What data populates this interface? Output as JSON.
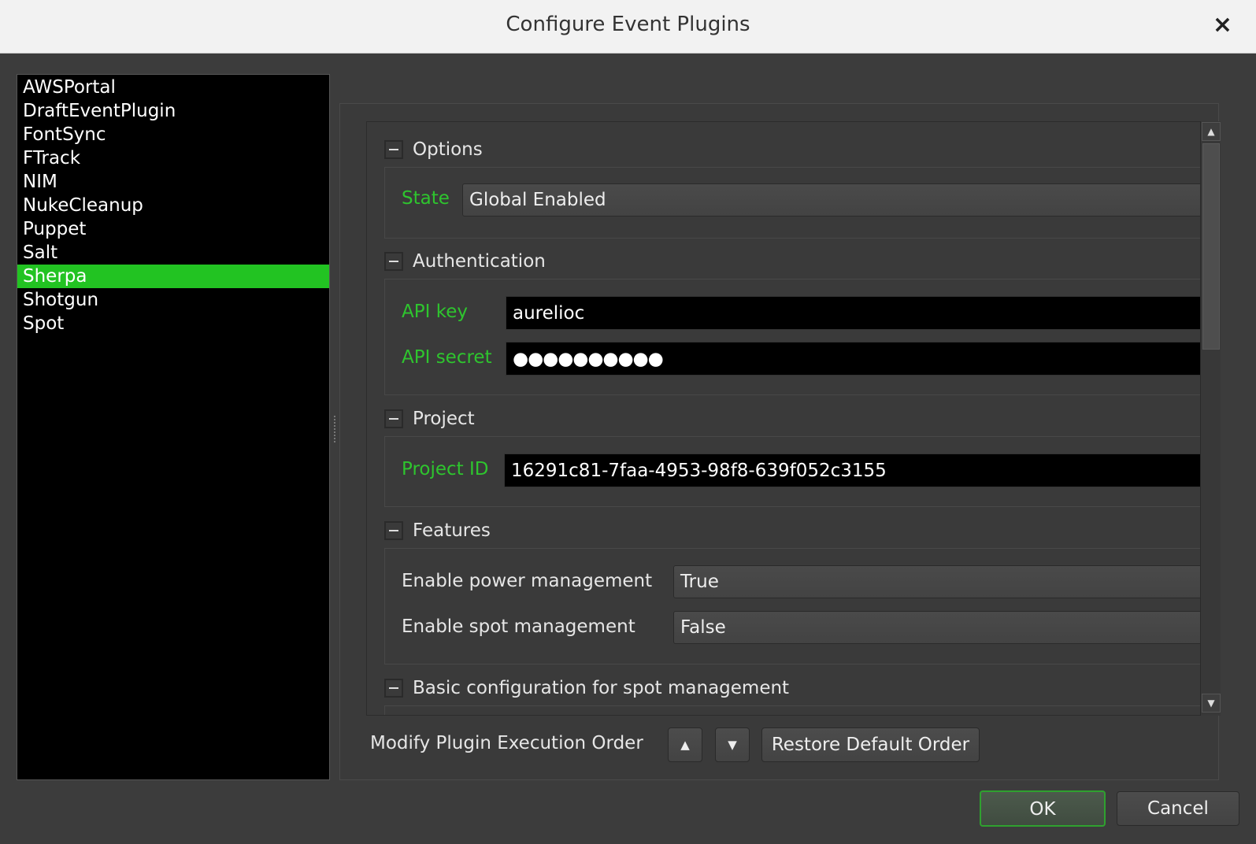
{
  "dialog": {
    "title": "Configure Event Plugins",
    "close_icon": "×"
  },
  "plugins": [
    "AWSPortal",
    "DraftEventPlugin",
    "FontSync",
    "FTrack",
    "NIM",
    "NukeCleanup",
    "Puppet",
    "Salt",
    "Sherpa",
    "Shotgun",
    "Spot"
  ],
  "selected_plugin": "Sherpa",
  "options": {
    "header": "Options",
    "state_label": "State",
    "state_value": "Global Enabled"
  },
  "authentication": {
    "header": "Authentication",
    "api_key_label": "API key",
    "api_key_value": "aurelioc",
    "api_secret_label": "API secret",
    "api_secret_value": "●●●●●●●●●●"
  },
  "project": {
    "header": "Project",
    "project_id_label": "Project ID",
    "project_id_value": "16291c81-7faa-4953-98f8-639f052c3155"
  },
  "features": {
    "header": "Features",
    "power_label": "Enable power management",
    "power_value": "True",
    "spot_label": "Enable spot management",
    "spot_value": "False"
  },
  "spot_config": {
    "header": "Basic configuration for spot management"
  },
  "order": {
    "label": "Modify Plugin Execution Order",
    "up": "▲",
    "down": "▼",
    "restore": "Restore Default Order"
  },
  "footer": {
    "ok": "OK",
    "cancel": "Cancel"
  },
  "colors": {
    "accent": "#22c322",
    "label_green": "#2ec52e"
  }
}
